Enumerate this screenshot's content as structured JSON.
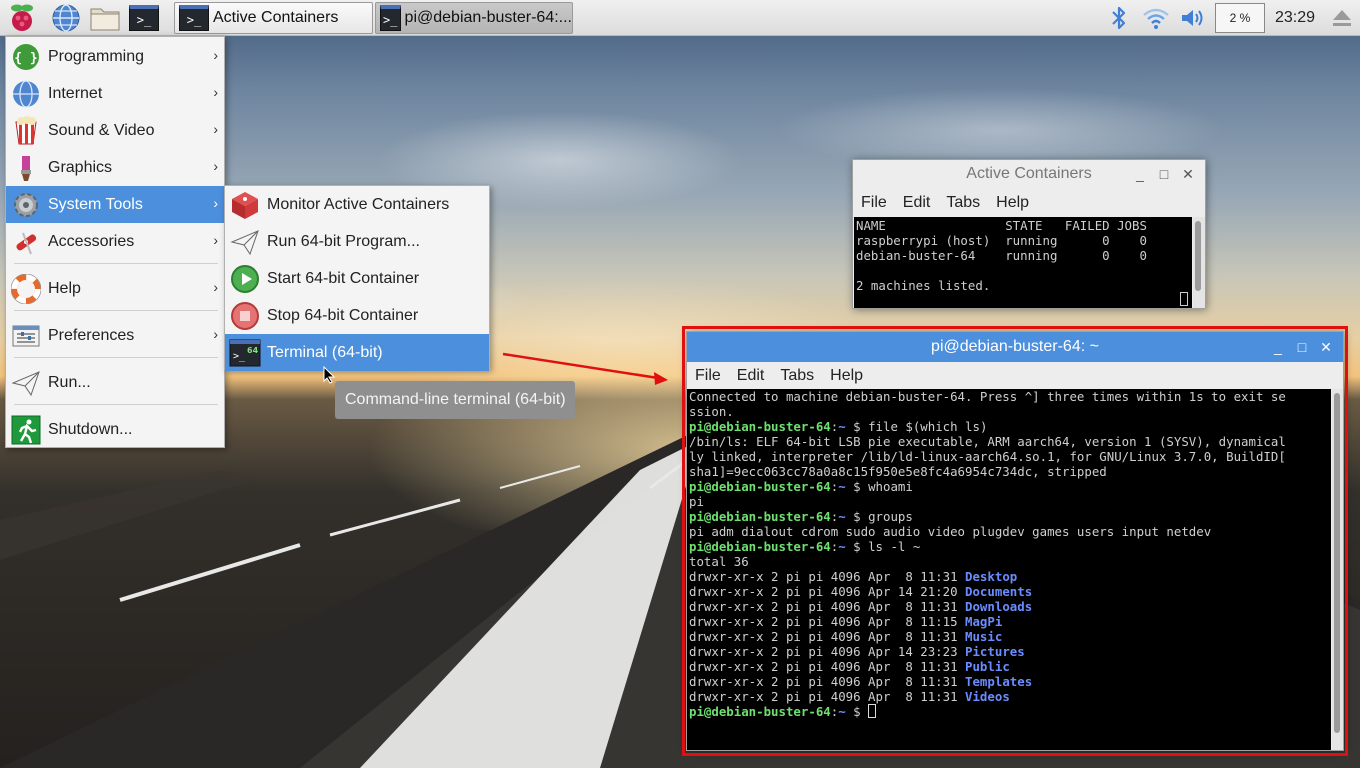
{
  "taskbar": {
    "launchers": [
      {
        "name": "raspberry-menu-icon"
      },
      {
        "name": "web-browser-icon"
      },
      {
        "name": "file-manager-icon"
      },
      {
        "name": "terminal-icon"
      }
    ],
    "tasks": [
      {
        "label": "Active Containers",
        "state": "active"
      },
      {
        "label": "pi@debian-buster-64:...",
        "state": "inactive"
      }
    ],
    "cpu_usage": "2 %",
    "clock": "23:29"
  },
  "main_menu": {
    "items": [
      {
        "label": "Programming",
        "icon": "programming-icon",
        "has_submenu": true
      },
      {
        "label": "Internet",
        "icon": "internet-globe-icon",
        "has_submenu": true
      },
      {
        "label": "Sound & Video",
        "icon": "sound-video-icon",
        "has_submenu": true
      },
      {
        "label": "Graphics",
        "icon": "graphics-brush-icon",
        "has_submenu": true
      },
      {
        "label": "System Tools",
        "icon": "gear-icon",
        "has_submenu": true,
        "selected": true
      },
      {
        "label": "Accessories",
        "icon": "accessories-icon",
        "has_submenu": true
      },
      {
        "label": "Help",
        "icon": "help-lifebuoy-icon",
        "has_submenu": true
      },
      {
        "label": "Preferences",
        "icon": "preferences-icon",
        "has_submenu": true
      },
      {
        "label": "Run...",
        "icon": "run-plane-icon",
        "has_submenu": false
      },
      {
        "label": "Shutdown...",
        "icon": "shutdown-exit-icon",
        "has_submenu": false
      }
    ]
  },
  "submenu": {
    "items": [
      {
        "label": "Monitor Active Containers",
        "icon": "container-box-icon"
      },
      {
        "label": "Run 64-bit Program...",
        "icon": "run-plane-icon"
      },
      {
        "label": "Start 64-bit Container",
        "icon": "play-icon"
      },
      {
        "label": "Stop 64-bit Container",
        "icon": "stop-icon"
      },
      {
        "label": "Terminal (64-bit)",
        "icon": "terminal-64-icon",
        "selected": true
      }
    ]
  },
  "tooltip": "Command-line terminal (64-bit)",
  "active_containers_window": {
    "title": "Active Containers",
    "menu": [
      "File",
      "Edit",
      "Tabs",
      "Help"
    ],
    "lines": [
      "NAME                STATE   FAILED JOBS",
      "raspberrypi (host)  running      0    0",
      "debian-buster-64    running      0    0",
      "",
      "2 machines listed."
    ]
  },
  "terminal_window": {
    "title": "pi@debian-buster-64: ~",
    "menu": [
      "File",
      "Edit",
      "Tabs",
      "Help"
    ],
    "lines": [
      {
        "segments": [
          {
            "t": "Connected to machine debian-buster-64. Press ^] three times within 1s to exit se",
            "c": "out"
          }
        ]
      },
      {
        "segments": [
          {
            "t": "ssion.",
            "c": "out"
          }
        ]
      },
      {
        "segments": [
          {
            "t": "pi@debian-buster-64",
            "c": "prompt"
          },
          {
            "t": ":",
            "c": "out"
          },
          {
            "t": "~",
            "c": "dir"
          },
          {
            "t": " $ file $(which ls)",
            "c": "out"
          }
        ]
      },
      {
        "segments": [
          {
            "t": "/bin/ls: ELF 64-bit LSB pie executable, ARM aarch64, version 1 (SYSV), dynamical",
            "c": "out"
          }
        ]
      },
      {
        "segments": [
          {
            "t": "ly linked, interpreter /lib/ld-linux-aarch64.so.1, for GNU/Linux 3.7.0, BuildID[",
            "c": "out"
          }
        ]
      },
      {
        "segments": [
          {
            "t": "sha1]=9ecc063cc78a0a8c15f950e5e8fc4a6954c734dc, stripped",
            "c": "out"
          }
        ]
      },
      {
        "segments": [
          {
            "t": "pi@debian-buster-64",
            "c": "prompt"
          },
          {
            "t": ":",
            "c": "out"
          },
          {
            "t": "~",
            "c": "dir"
          },
          {
            "t": " $ whoami",
            "c": "out"
          }
        ]
      },
      {
        "segments": [
          {
            "t": "pi",
            "c": "out"
          }
        ]
      },
      {
        "segments": [
          {
            "t": "pi@debian-buster-64",
            "c": "prompt"
          },
          {
            "t": ":",
            "c": "out"
          },
          {
            "t": "~",
            "c": "dir"
          },
          {
            "t": " $ groups",
            "c": "out"
          }
        ]
      },
      {
        "segments": [
          {
            "t": "pi adm dialout cdrom sudo audio video plugdev games users input netdev",
            "c": "out"
          }
        ]
      },
      {
        "segments": [
          {
            "t": "pi@debian-buster-64",
            "c": "prompt"
          },
          {
            "t": ":",
            "c": "out"
          },
          {
            "t": "~",
            "c": "dir"
          },
          {
            "t": " $ ls -l ~",
            "c": "out"
          }
        ]
      },
      {
        "segments": [
          {
            "t": "total 36",
            "c": "out"
          }
        ]
      },
      {
        "segments": [
          {
            "t": "drwxr-xr-x 2 pi pi 4096 Apr  8 11:31 ",
            "c": "out"
          },
          {
            "t": "Desktop",
            "c": "dir"
          }
        ]
      },
      {
        "segments": [
          {
            "t": "drwxr-xr-x 2 pi pi 4096 Apr 14 21:20 ",
            "c": "out"
          },
          {
            "t": "Documents",
            "c": "dir"
          }
        ]
      },
      {
        "segments": [
          {
            "t": "drwxr-xr-x 2 pi pi 4096 Apr  8 11:31 ",
            "c": "out"
          },
          {
            "t": "Downloads",
            "c": "dir"
          }
        ]
      },
      {
        "segments": [
          {
            "t": "drwxr-xr-x 2 pi pi 4096 Apr  8 11:15 ",
            "c": "out"
          },
          {
            "t": "MagPi",
            "c": "dir"
          }
        ]
      },
      {
        "segments": [
          {
            "t": "drwxr-xr-x 2 pi pi 4096 Apr  8 11:31 ",
            "c": "out"
          },
          {
            "t": "Music",
            "c": "dir"
          }
        ]
      },
      {
        "segments": [
          {
            "t": "drwxr-xr-x 2 pi pi 4096 Apr 14 23:23 ",
            "c": "out"
          },
          {
            "t": "Pictures",
            "c": "dir"
          }
        ]
      },
      {
        "segments": [
          {
            "t": "drwxr-xr-x 2 pi pi 4096 Apr  8 11:31 ",
            "c": "out"
          },
          {
            "t": "Public",
            "c": "dir"
          }
        ]
      },
      {
        "segments": [
          {
            "t": "drwxr-xr-x 2 pi pi 4096 Apr  8 11:31 ",
            "c": "out"
          },
          {
            "t": "Templates",
            "c": "dir"
          }
        ]
      },
      {
        "segments": [
          {
            "t": "drwxr-xr-x 2 pi pi 4096 Apr  8 11:31 ",
            "c": "out"
          },
          {
            "t": "Videos",
            "c": "dir"
          }
        ]
      },
      {
        "segments": [
          {
            "t": "pi@debian-buster-64",
            "c": "prompt"
          },
          {
            "t": ":",
            "c": "out"
          },
          {
            "t": "~",
            "c": "dir"
          },
          {
            "t": " $ ",
            "c": "out"
          }
        ]
      }
    ]
  },
  "colors": {
    "menu_selection": "#4b8fdd",
    "terminal_titlebar": "#4b8fdd",
    "prompt_green": "#6ee06e",
    "directory_blue": "#6b8cff",
    "annotation_red": "#e01010"
  }
}
